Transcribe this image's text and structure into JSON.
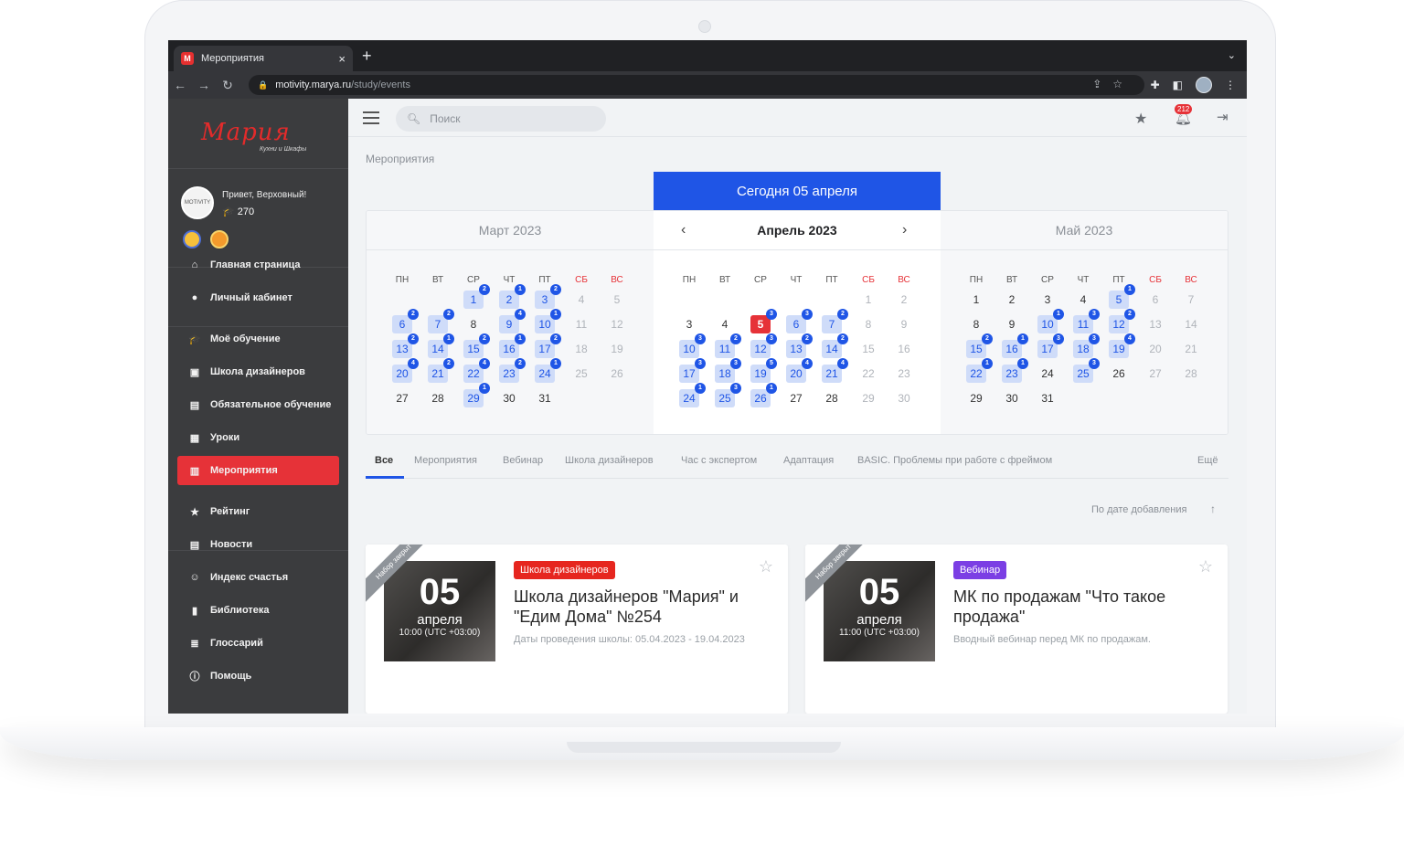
{
  "browser": {
    "tab_title": "Мероприятия",
    "url_host": "motivity.marya.ru",
    "url_path": "/study/events"
  },
  "brand": {
    "logo_text": "Мария",
    "logo_sub": "Кухни и Шкафы",
    "accent": "#e63238",
    "primary": "#1f55e6"
  },
  "user": {
    "greeting": "Привет, Верховный!",
    "points": "270",
    "avatar_text": "MOTIVITY"
  },
  "sidebar": {
    "items": [
      {
        "label": "Главная страница",
        "icon": "home-icon"
      },
      {
        "label": "Личный кабинет",
        "icon": "user-icon"
      },
      {
        "label": "Моё обучение",
        "icon": "graduation-icon"
      },
      {
        "label": "Школа дизайнеров",
        "icon": "school-icon"
      },
      {
        "label": "Обязательное обучение",
        "icon": "book-icon"
      },
      {
        "label": "Уроки",
        "icon": "lesson-icon"
      },
      {
        "label": "Мероприятия",
        "icon": "calendar-icon",
        "active": true
      },
      {
        "label": "Рейтинг",
        "icon": "trophy-icon"
      },
      {
        "label": "Новости",
        "icon": "news-icon"
      },
      {
        "label": "Индекс счастья",
        "icon": "smile-icon"
      },
      {
        "label": "Библиотека",
        "icon": "library-icon"
      },
      {
        "label": "Глоссарий",
        "icon": "glossary-icon"
      },
      {
        "label": "Помощь",
        "icon": "help-icon"
      }
    ]
  },
  "topbar": {
    "search_placeholder": "Поиск",
    "notifications_count": "212"
  },
  "page": {
    "breadcrumb": "Мероприятия",
    "today_banner": "Сегодня 05 апреля"
  },
  "calendar": {
    "weekdays": [
      "ПН",
      "ВТ",
      "СР",
      "ЧТ",
      "ПТ",
      "СБ",
      "ВС"
    ],
    "months": [
      {
        "title": "Март 2023",
        "offset": 2,
        "days": 31,
        "events": {
          "1": 2,
          "2": 1,
          "3": 2,
          "6": 2,
          "7": 2,
          "9": 4,
          "10": 1,
          "13": 2,
          "14": 1,
          "15": 2,
          "16": 1,
          "17": 2,
          "20": 4,
          "21": 2,
          "22": 4,
          "23": 2,
          "24": 1,
          "29": 1
        }
      },
      {
        "title": "Апрель 2023",
        "offset": 5,
        "days": 30,
        "today": 5,
        "events": {
          "5": 3,
          "6": 3,
          "7": 2,
          "10": 3,
          "11": 2,
          "12": 3,
          "13": 2,
          "14": 2,
          "17": 3,
          "18": 3,
          "19": 5,
          "20": 4,
          "21": 4,
          "24": 1,
          "25": 3,
          "26": 1
        }
      },
      {
        "title": "Май 2023",
        "offset": 0,
        "days": 31,
        "events": {
          "5": 1,
          "10": 1,
          "11": 3,
          "12": 2,
          "15": 2,
          "16": 1,
          "17": 3,
          "18": 3,
          "19": 4,
          "22": 1,
          "23": 1,
          "25": 3
        }
      }
    ]
  },
  "filters": {
    "tabs": [
      "Все",
      "Мероприятия",
      "Вебинар",
      "Школа дизайнеров",
      "Час с экспертом",
      "Адаптация",
      "BASIC. Проблемы при работе с фреймом"
    ],
    "more": "Ещё",
    "sort_label": "По дате добавления"
  },
  "events": [
    {
      "ribbon": "Набор закрыт",
      "day": "05",
      "month": "апреля",
      "time": "10:00 (UTC +03:00)",
      "tag": "Школа дизайнеров",
      "tag_color": "#e6261f",
      "title": "Школа дизайнеров \"Мария\" и \"Едим Дома\" №254",
      "desc": "Даты проведения школы: 05.04.2023 - 19.04.2023"
    },
    {
      "ribbon": "Набор закрыт",
      "day": "05",
      "month": "апреля",
      "time": "11:00 (UTC +03:00)",
      "tag": "Вебинар",
      "tag_color": "#7b3fe4",
      "title": "МК по продажам \"Что такое продажа\"",
      "desc": "Вводный вебинар перед МК по продажам."
    }
  ]
}
